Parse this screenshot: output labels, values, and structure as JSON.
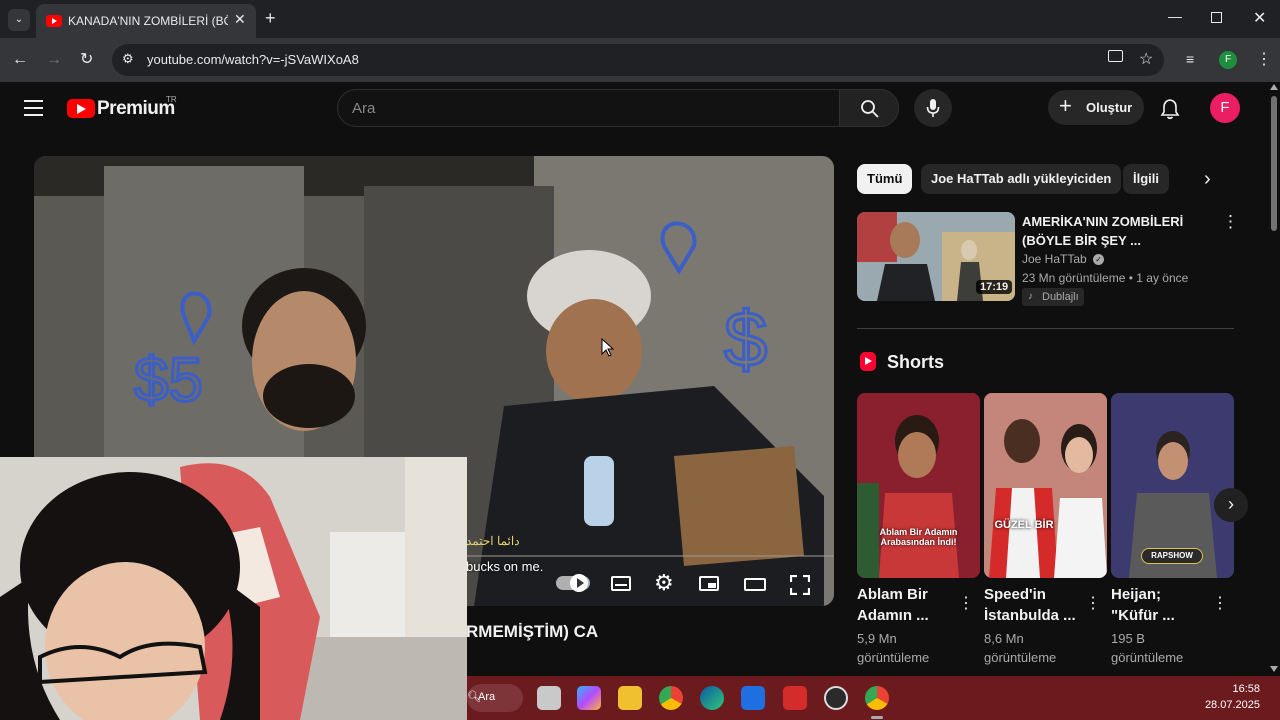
{
  "browser": {
    "tab_title": "KANADA'NIN ZOMBİLERİ (BÖYLE",
    "url": "youtube.com/watch?v=-jSVaWIXoA8"
  },
  "youtube": {
    "logo_text": "Premium",
    "logo_sup": "TR",
    "search_placeholder": "Ara",
    "create_label": "Oluştur",
    "avatar_letter": "F",
    "video_title_partial": "RMEMİŞTİM) CA",
    "subtitle_arabic": "دائما احتمد",
    "subtitle_english": "bucks on me.",
    "chips": [
      "Tümü",
      "Joe HaTTab adlı yükleyiciden",
      "İlgili"
    ],
    "rec": {
      "title_line1": "AMERİKA'NIN ZOMBİLERİ",
      "title_line2": "(BÖYLE BİR ŞEY ...",
      "channel": "Joe HaTTab",
      "meta": "23 Mn görüntüleme • 1 ay önce",
      "badge": "Dublajlı",
      "duration": "17:19"
    },
    "shorts_heading": "Shorts",
    "shorts": [
      {
        "title1": "Ablam Bir",
        "title2": "Adamın ...",
        "views1": "5,9 Mn",
        "views2": "görüntüleme",
        "overlay": "Ablam Bir Adamın Arabasından İndi!"
      },
      {
        "title1": "Speed'in",
        "title2": "İstanbulda ...",
        "views1": "8,6 Mn",
        "views2": "görüntüleme",
        "overlay": "GÜZEL BİR"
      },
      {
        "title1": "Heijan;",
        "title2": "\"Küfür ...",
        "views1": "195 B",
        "views2": "görüntüleme",
        "overlay": "RAPSHOW"
      }
    ]
  },
  "taskbar": {
    "search_label": "Ara",
    "time": "16:58",
    "date": "28.07.2025"
  },
  "colors": {
    "yt_bg": "#0f0f0f",
    "brand_red": "#ff0000",
    "taskbar": "#6b1a1e",
    "avatar": "#e91e63"
  }
}
